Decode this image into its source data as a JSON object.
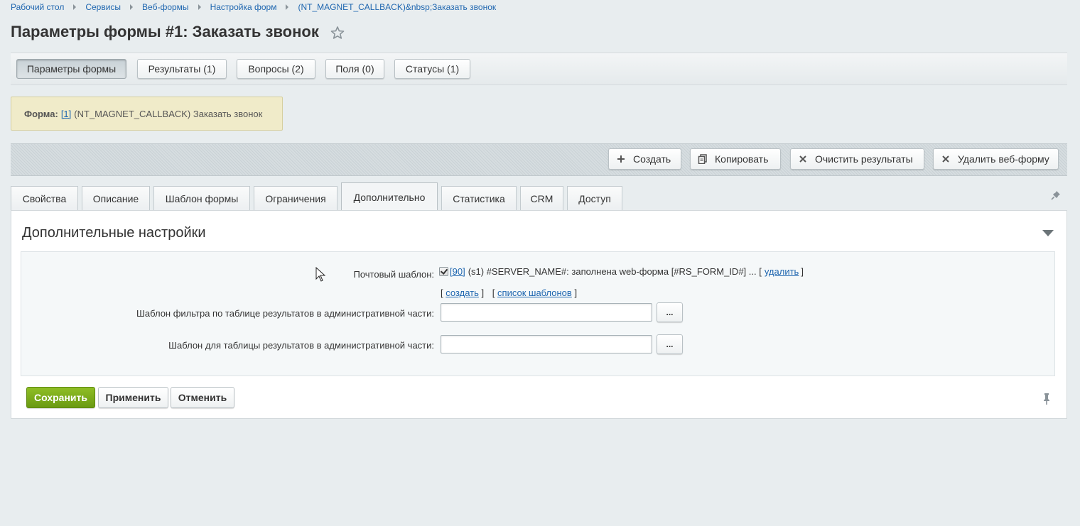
{
  "breadcrumb": [
    "Рабочий стол",
    "Сервисы",
    "Веб-формы",
    "Настройка форм",
    "(NT_MAGNET_CALLBACK)&nbsp;Заказать звонок"
  ],
  "page_title": "Параметры формы #1: Заказать звонок",
  "topnav": {
    "items": [
      "Параметры формы",
      "Результаты (1)",
      "Вопросы (2)",
      "Поля (0)",
      "Статусы (1)"
    ],
    "active": "Параметры формы"
  },
  "form_info": {
    "label": "Форма:",
    "id_link": "[1]",
    "text": "(NT_MAGNET_CALLBACK) Заказать звонок"
  },
  "toolbar": {
    "create": "Создать",
    "copy": "Копировать",
    "clear_results": "Очистить результаты",
    "delete_form": "Удалить веб-форму"
  },
  "tabs": {
    "items": [
      "Свойства",
      "Описание",
      "Шаблон формы",
      "Ограничения",
      "Дополнительно",
      "Статистика",
      "CRM",
      "Доступ"
    ],
    "active": "Дополнительно"
  },
  "section": {
    "title": "Дополнительные настройки",
    "mail_template": {
      "label": "Почтовый шаблон:",
      "checked": true,
      "id_link": "[90]",
      "text": "(s1) #SERVER_NAME#: заполнена web-форма [#RS_FORM_ID#] ... [",
      "delete_link": "удалить",
      "close_bracket": "]"
    },
    "links": {
      "open1": "[",
      "create": "создать",
      "close1": "]",
      "open2": "[",
      "list": "список шаблонов",
      "close2": "]"
    },
    "filter_template": {
      "label": "Шаблон фильтра по таблице результатов в административной части:",
      "value": "",
      "button": "..."
    },
    "table_template": {
      "label": "Шаблон для таблицы результатов в административной части:",
      "value": "",
      "button": "..."
    }
  },
  "footer": {
    "save": "Сохранить",
    "apply": "Применить",
    "cancel": "Отменить"
  },
  "colors": {
    "accent": "#2067b0",
    "save_button": "#7aab1a",
    "form_box_bg": "#f0ebc9"
  }
}
